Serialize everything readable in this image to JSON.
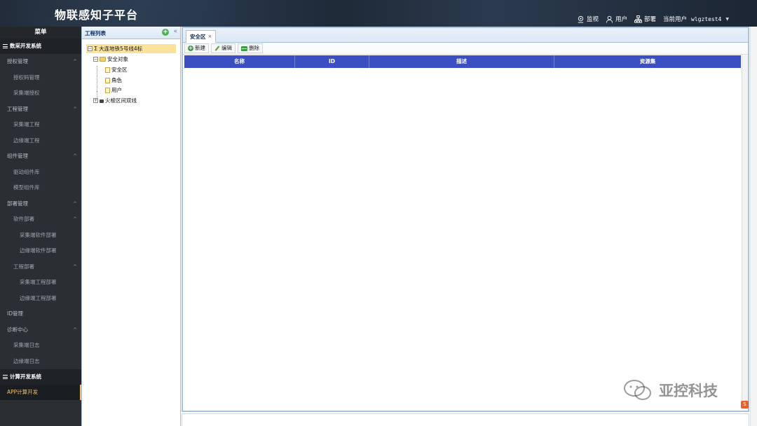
{
  "header": {
    "title": "物联感知子平台",
    "nav": [
      {
        "label": "监视",
        "icon": "monitor-pin-icon"
      },
      {
        "label": "用户",
        "icon": "user-icon"
      },
      {
        "label": "部署",
        "icon": "org-chart-icon"
      }
    ],
    "current_user_label": "当前用户",
    "current_user_name": "wlgztest4"
  },
  "sidebar": {
    "title": "菜单",
    "section1": "数采开发系统",
    "items": {
      "auth_mgmt": "授权管理",
      "auth_code_mgmt": "授权码管理",
      "collector_auth": "采集端授权",
      "project_mgmt": "工程管理",
      "collector_project": "采集端工程",
      "edge_project": "边缘端工程",
      "component_mgmt": "组件管理",
      "driver_lib": "驱动组件库",
      "model_lib": "模型组件库",
      "deploy_mgmt": "部署管理",
      "software_deploy": "软件部署",
      "collector_sw_deploy": "采集端软件部署",
      "edge_sw_deploy": "边缘端软件部署",
      "project_deploy": "工程部署",
      "collector_proj_deploy": "采集端工程部署",
      "edge_proj_deploy": "边缘端工程部署",
      "id_mgmt": "ID管理",
      "diag_center": "诊断中心",
      "collector_log": "采集端日志",
      "edge_log": "边缘端日志"
    },
    "section2": "计算开发系统",
    "active_item": "APP计算开发"
  },
  "tree": {
    "title": "工程列表",
    "root": "大连地铁5号线4标",
    "security_objects": "安全对象",
    "security_zone": "安全区",
    "role": "角色",
    "user": "用户",
    "second_root": "火梭区间双线"
  },
  "main": {
    "tab_label": "安全区",
    "tab_close": "×",
    "toolbar": {
      "new": "新建",
      "edit": "编辑",
      "delete": "删除"
    },
    "columns": [
      "名称",
      "ID",
      "描述",
      "资源集"
    ]
  },
  "watermark": "亚控科技",
  "colors": {
    "grid_header": "#3b4fc3",
    "selected_row": "#fbe29a",
    "active_menu": "#f0c16a"
  }
}
